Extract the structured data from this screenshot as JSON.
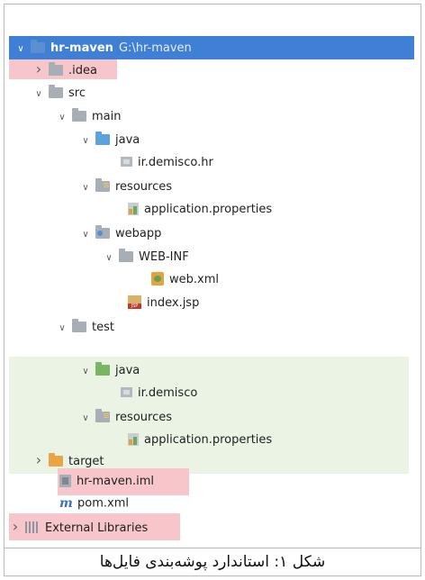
{
  "project_tree": {
    "root": {
      "name": "hr-maven",
      "path": "G:\\hr-maven"
    },
    "items": [
      {
        "label": ".idea"
      },
      {
        "label": "src"
      },
      {
        "label": "main"
      },
      {
        "label": "java"
      },
      {
        "label": "ir.demisco.hr"
      },
      {
        "label": "resources"
      },
      {
        "label": "application.properties"
      },
      {
        "label": "webapp"
      },
      {
        "label": "WEB-INF"
      },
      {
        "label": "web.xml"
      },
      {
        "label": "index.jsp"
      },
      {
        "label": "test"
      },
      {
        "label": "java"
      },
      {
        "label": "ir.demisco"
      },
      {
        "label": "resources"
      },
      {
        "label": "application.properties"
      },
      {
        "label": "target"
      },
      {
        "label": "hr-maven.iml"
      },
      {
        "label": "pom.xml"
      },
      {
        "label": "External Libraries"
      }
    ]
  },
  "caption": "شکل ۱: استاندارد پوشه‌بندی فایل‌ها",
  "colors": {
    "selection": "#3f7fd6",
    "highlight_pink": "#f6c6ca",
    "test_band_green": "#eaf3e4"
  }
}
